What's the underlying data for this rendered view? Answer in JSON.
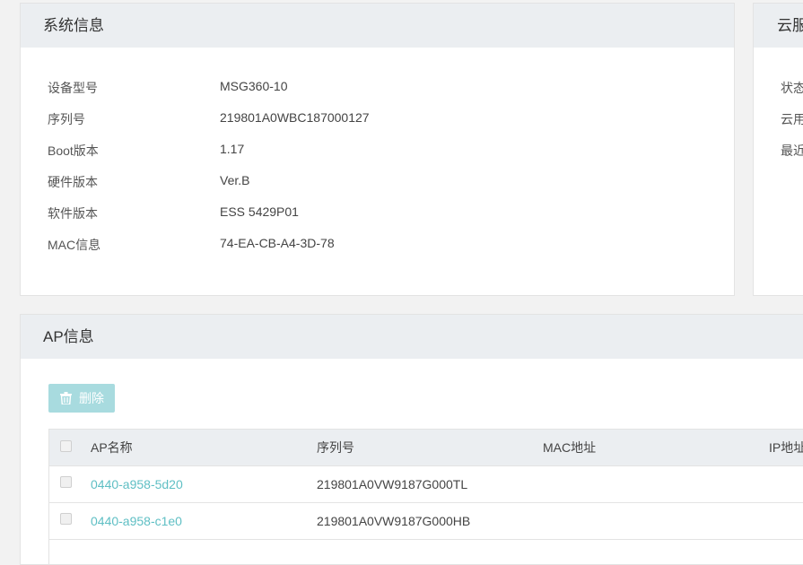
{
  "system_panel": {
    "title": "系统信息",
    "rows": [
      {
        "label": "设备型号",
        "value": "MSG360-10"
      },
      {
        "label": "序列号",
        "value": "219801A0WBC187000127"
      },
      {
        "label": "Boot版本",
        "value": "1.17"
      },
      {
        "label": "硬件版本",
        "value": "Ver.B"
      },
      {
        "label": "软件版本",
        "value": "ESS 5429P01"
      },
      {
        "label": "MAC信息",
        "value": "74-EA-CB-A4-3D-78"
      }
    ]
  },
  "cloud_panel": {
    "title": "云服",
    "rows": [
      {
        "label": "状态"
      },
      {
        "label": "云用"
      },
      {
        "label": "最近"
      }
    ]
  },
  "ap_panel": {
    "title": "AP信息",
    "delete_button": {
      "label": "删除",
      "icon": "trash-icon"
    },
    "table": {
      "columns": [
        "AP名称",
        "序列号",
        "MAC地址",
        "IP地址"
      ],
      "rows": [
        {
          "name": "0440-a958-5d20",
          "serial": "219801A0VW9187G000TL",
          "mac": "",
          "ip": ""
        },
        {
          "name": "0440-a958-c1e0",
          "serial": "219801A0VW9187G000HB",
          "mac": "",
          "ip": ""
        }
      ]
    }
  },
  "colors": {
    "header_bg": "#ebeef1",
    "accent": "#5fbfc4",
    "button_disabled": "#a8dbdf"
  }
}
